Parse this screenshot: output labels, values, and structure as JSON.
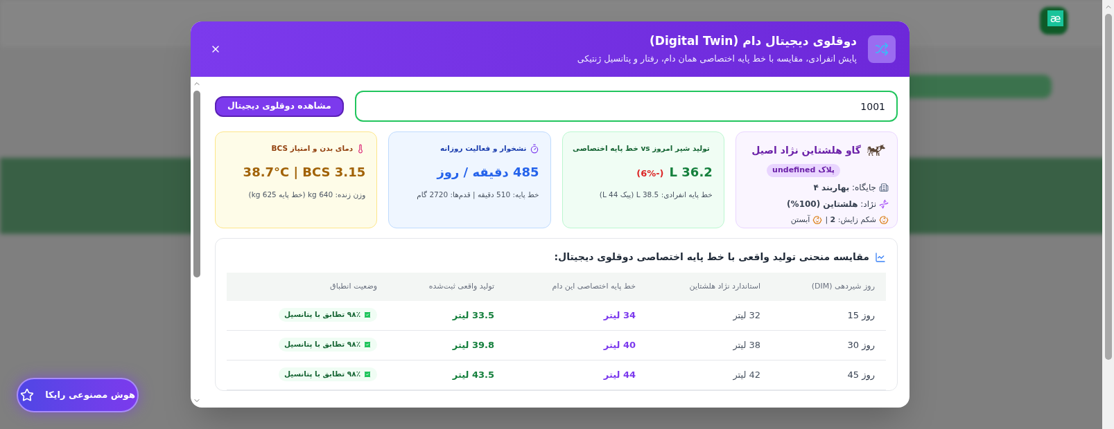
{
  "extension_badge": "æ",
  "modal": {
    "title": "دوقلوی دیجیتال دام (Digital Twin)",
    "subtitle": "پایش انفرادی، مقایسه با خط پایه اختصاصی همان دام، رفتار و پتانسیل ژنتیکی",
    "search": {
      "value": "1001",
      "button": "مشاهده دوقلوی دیجیتال"
    },
    "cow_card": {
      "title": "گاو هلشتاین نژاد اصیل",
      "tag": "پلاک undefined",
      "location": "جایگاه: **بهاربند ۴**",
      "breed": "نژاد: **هلشتاین (100%)**",
      "lactation": "شکم زایش: **2** |",
      "status": "آبستن"
    },
    "metric_cards": [
      {
        "kind": "milk",
        "title": "تولید شیر امروز vs خط پایه اختصاصی",
        "value": "36.2 L",
        "delta": "(-6%)",
        "note": "خط پایه انفرادی: 38.5 L (پیک 44 L)"
      },
      {
        "kind": "activity",
        "title": "نشخوار و فعالیت روزانه",
        "value": "485 دقیقه / روز",
        "note": "خط پایه: 510 دقیقه | قدم‌ها: 2720 گام"
      },
      {
        "kind": "temperature",
        "title": "دمای بدن و امتیاز BCS",
        "value": "38.7°C | BCS 3.15",
        "note": "وزن زنده: 640 kg (خط پایه 625 kg)"
      }
    ],
    "comparison": {
      "title": "مقایسه منحنی تولید واقعی با خط پایه اختصاصی دوقلوی دیجیتال:",
      "columns": [
        "روز شیردهی (DIM)",
        "استاندارد نژاد هلشتاین",
        "خط پایه اختصاصی این دام",
        "تولید واقعی ثبت‌شده",
        "وضعیت انطباق"
      ],
      "rows": [
        {
          "day": "روز 15",
          "standard": "32 لیتر",
          "baseline": "34 لیتر",
          "actual": "33.5 لیتر",
          "status": "۹۸٪ تطابق با پتانسیل"
        },
        {
          "day": "روز 30",
          "standard": "38 لیتر",
          "baseline": "40 لیتر",
          "actual": "39.8 لیتر",
          "status": "۹۸٪ تطابق با پتانسیل"
        },
        {
          "day": "روز 45",
          "standard": "42 لیتر",
          "baseline": "44 لیتر",
          "actual": "43.5 لیتر",
          "status": "۹۸٪ تطابق با پتانسیل"
        }
      ]
    }
  },
  "ai_button": "هوش مصنوعی رایکا"
}
